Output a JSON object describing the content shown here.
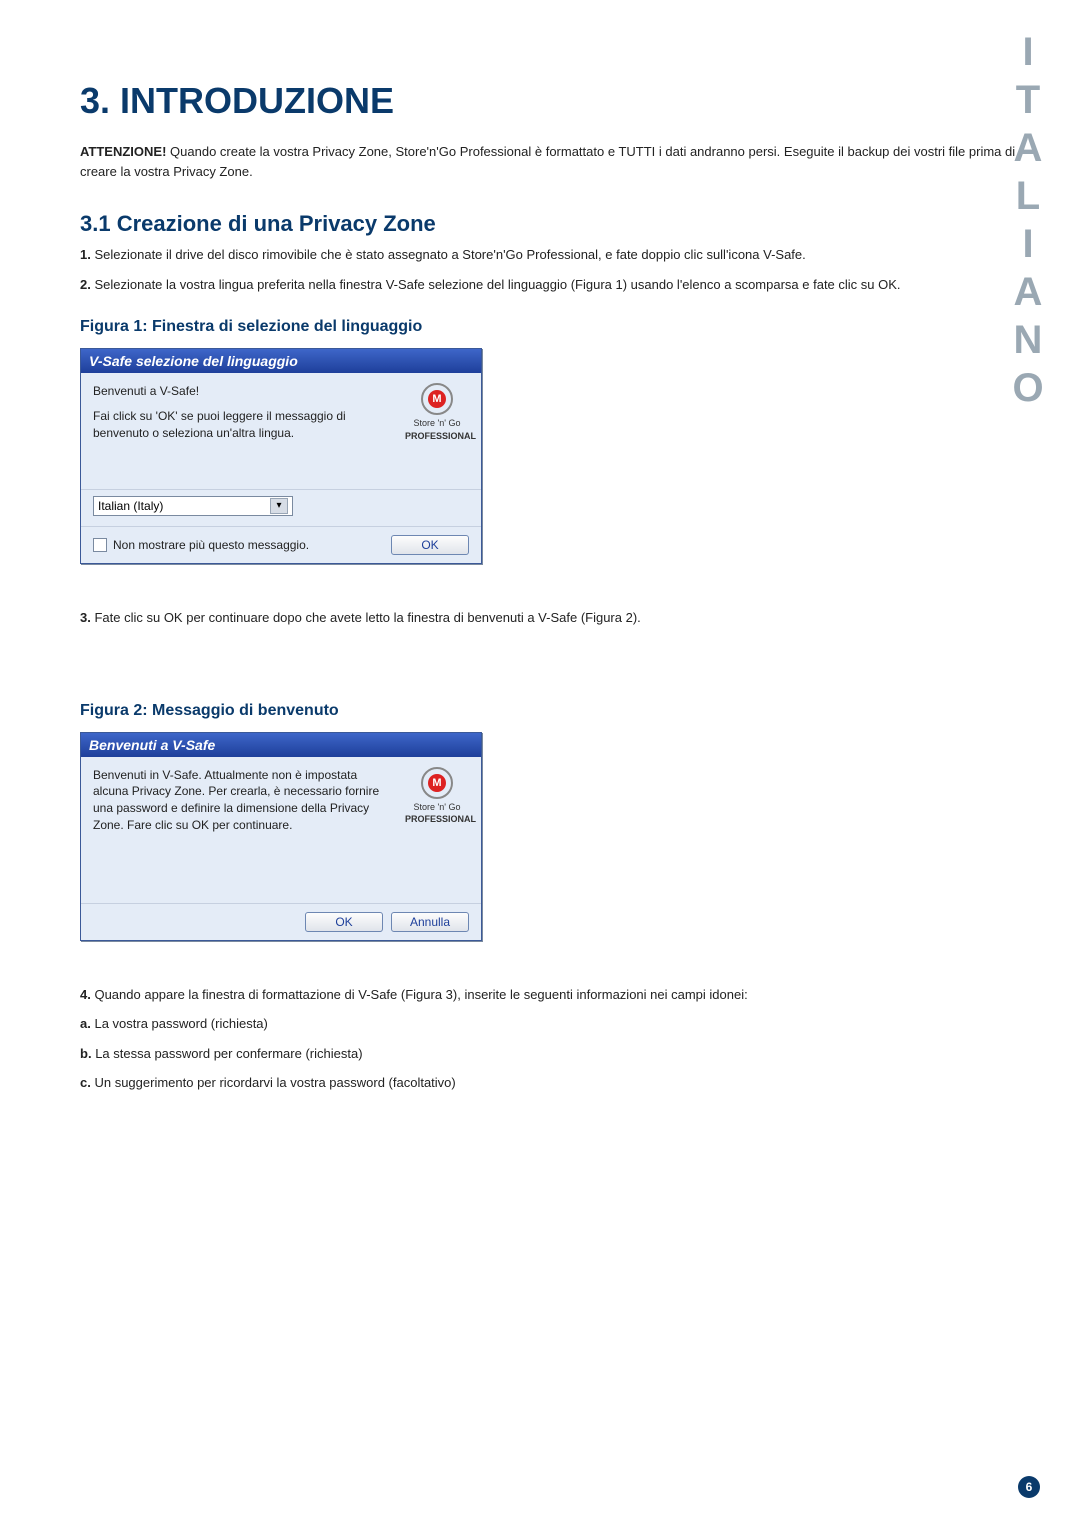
{
  "side_label": "ITALIANO",
  "heading": "3. INTRODUZIONE",
  "warning": {
    "label": "ATTENZIONE!",
    "text": "Quando create la vostra Privacy Zone, Store'n'Go Professional è formattato e TUTTI i dati andranno persi. Eseguite il backup dei vostri file prima di creare la vostra Privacy Zone."
  },
  "section_title": "3.1 Creazione di una Privacy Zone",
  "step1": {
    "n": "1.",
    "t": "Selezionate il drive del disco rimovibile che è stato assegnato a Store'n'Go Professional, e fate doppio clic sull'icona V-Safe."
  },
  "step2": {
    "n": "2.",
    "t": "Selezionate la vostra lingua preferita nella finestra V-Safe selezione del linguaggio (Figura 1) usando l'elenco a scomparsa e fate clic su OK."
  },
  "fig1_caption": "Figura 1: Finestra di selezione del linguaggio",
  "dialog1": {
    "title": "V-Safe selezione del linguaggio",
    "line1": "Benvenuti a V-Safe!",
    "line2": "Fai click su 'OK' se puoi leggere il messaggio di benvenuto o seleziona un'altra lingua.",
    "logo_top": "Store 'n' Go",
    "logo_bottom": "PROFESSIONAL",
    "logo_letter": "M",
    "select_value": "Italian (Italy)",
    "checkbox_label": "Non mostrare più questo messaggio.",
    "ok": "OK"
  },
  "step3": {
    "n": "3.",
    "t": "Fate clic su OK per continuare dopo che avete letto la finestra di benvenuti a V-Safe (Figura 2)."
  },
  "fig2_caption": "Figura 2: Messaggio di benvenuto",
  "dialog2": {
    "title": "Benvenuti a V-Safe",
    "body": "Benvenuti in V-Safe. Attualmente non è impostata alcuna Privacy Zone. Per crearla, è necessario fornire una password e definire la dimensione della Privacy Zone. Fare clic su OK per continuare.",
    "logo_top": "Store 'n' Go",
    "logo_bottom": "PROFESSIONAL",
    "logo_letter": "M",
    "ok": "OK",
    "cancel": "Annulla"
  },
  "step4": {
    "n": "4.",
    "t": "Quando appare la finestra di formattazione di V-Safe (Figura 3), inserite le seguenti informazioni nei campi idonei:"
  },
  "step4a": {
    "n": "a.",
    "t": "La vostra password (richiesta)"
  },
  "step4b": {
    "n": "b.",
    "t": "La stessa password per confermare (richiesta)"
  },
  "step4c": {
    "n": "c.",
    "t": "Un suggerimento per ricordarvi la vostra password (facoltativo)"
  },
  "page_number": "6"
}
